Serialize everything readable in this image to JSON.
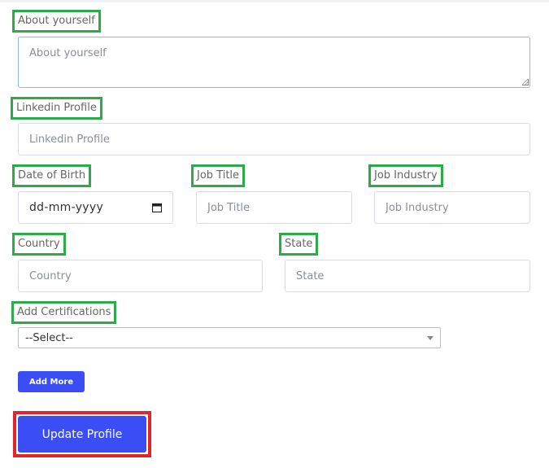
{
  "form": {
    "about": {
      "label": "About yourself",
      "placeholder": "About yourself"
    },
    "linkedin": {
      "label": "Linkedin Profile",
      "placeholder": "Linkedin Profile"
    },
    "dob": {
      "label": "Date of Birth",
      "value": "dd-mm-yyyy"
    },
    "job_title": {
      "label": "Job Title",
      "placeholder": "Job Title"
    },
    "job_industry": {
      "label": "Job Industry",
      "placeholder": "Job Industry"
    },
    "country": {
      "label": "Country",
      "placeholder": "Country"
    },
    "state": {
      "label": "State",
      "placeholder": "State"
    },
    "certifications": {
      "label": "Add Certifications",
      "selected": "--Select--"
    },
    "add_more_label": "Add More",
    "update_label": "Update Profile"
  },
  "colors": {
    "accent": "#3b4ef5",
    "label_highlight": "#2bab4a",
    "submit_highlight": "#e0262b"
  },
  "icons": {
    "calendar": "calendar-icon",
    "dropdown": "chevron-down-icon",
    "resize": "resize-grip-icon"
  }
}
